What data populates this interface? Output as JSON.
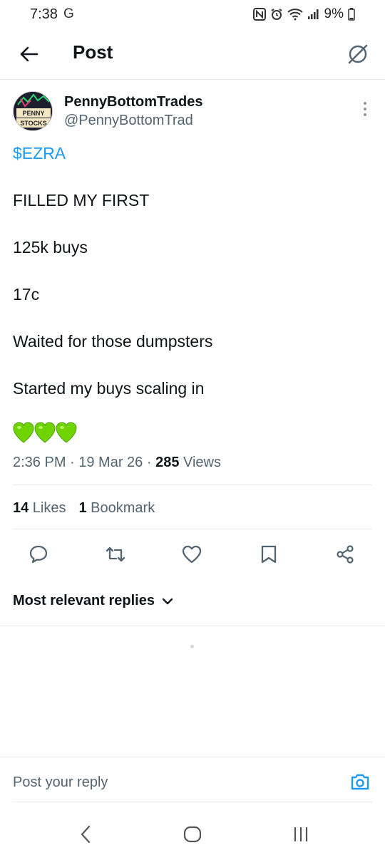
{
  "status_bar": {
    "time": "7:38",
    "carrier_icon": "G",
    "battery": "9%"
  },
  "header": {
    "title": "Post",
    "back_icon": "arrow-left-icon",
    "grok_icon": "grok-icon"
  },
  "post": {
    "author": {
      "display_name": "PennyBottomTrades",
      "handle": "@PennyBottomTrad",
      "avatar_text_top": "PENNY",
      "avatar_text_bottom": "STOCKS"
    },
    "cashtag": "$EZRA",
    "lines": [
      "FILLED MY FIRST",
      "125k buys",
      "17c",
      "Waited for those dumpsters",
      "Started my buys scaling in"
    ],
    "emoji": "💚💚💚",
    "timestamp": "2:36 PM · 19 Mar 26 · ",
    "views_count": "285",
    "views_label": " Views",
    "likes_count": "14",
    "likes_label": " Likes",
    "bookmarks_count": "1",
    "bookmarks_label": " Bookmark"
  },
  "actions": {
    "reply_icon": "reply-icon",
    "repost_icon": "repost-icon",
    "like_icon": "heart-icon",
    "bookmark_icon": "bookmark-icon",
    "share_icon": "share-icon"
  },
  "replies": {
    "sort_label": "Most relevant replies"
  },
  "reply_bar": {
    "placeholder": "Post your reply"
  },
  "colors": {
    "accent": "#1d9bf0",
    "text_primary": "#0f1419",
    "text_secondary": "#536471",
    "divider": "#e6e9eb"
  }
}
